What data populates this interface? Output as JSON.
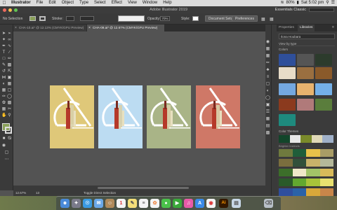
{
  "menubar": {
    "app": "Illustrator",
    "items": [
      "File",
      "Edit",
      "Object",
      "Type",
      "Select",
      "Effect",
      "View",
      "Window",
      "Help"
    ],
    "battery": "80%",
    "clock": "Sat 5:02 pm"
  },
  "window": {
    "title": "Adobe Illustrator 2019",
    "workspace": "Essentials Classic"
  },
  "control_bar": {
    "selection": "No Selection",
    "stroke_label": "Stroke:",
    "opacity_label": "Opacity:",
    "opacity_value": "70%",
    "style_label": "Style:",
    "document_setup": "Document Setup",
    "preferences": "Preferences"
  },
  "doc_tabs": [
    {
      "label": "CHA-10.ai* @ 12.13% (CMYK/GPU Preview)",
      "active": false
    },
    {
      "label": "CHA-09.ai* @ 12.67% (CMYK/GPU Preview)",
      "active": true
    }
  ],
  "status": {
    "zoom": "12.67%",
    "artboard": "13",
    "tool": "Toggle Direct Selection"
  },
  "artboards": [
    {
      "color": "#dfc879"
    },
    {
      "color": "#bcdcf2"
    },
    {
      "color": "#a9b487"
    },
    {
      "color": "#cf7867"
    }
  ],
  "panel": {
    "tabs": [
      "Properties",
      "Libraries"
    ],
    "library_name": "Ilona Houbara",
    "view_by": "View by type",
    "section_colors": "Colors",
    "section_color_themes": "Color Themes",
    "theme_name": "Brighter Instincts",
    "swatches": [
      "#2f4f9a",
      "#555555",
      "#2c3b2c",
      "#e8dcc8",
      "#9a6f40",
      "#8a5a2a",
      "#74a8e0",
      "#e8b36e",
      "#74b0e8",
      "#8b3a1e",
      "#b07a7a",
      "#5a7d3c",
      "#1e8a7e",
      "#ffffff",
      "#ffffff"
    ],
    "theme_row": [
      "#12452a",
      "#e8e8e8",
      "#7a8a2a",
      "#e0d9b8",
      "#9fb0c8"
    ],
    "theme_rows": [
      [
        "#6f7a3e",
        "#1f5e3a",
        "#e8c24a",
        "#a89c66"
      ],
      [
        "#7a6e3e",
        "#31503a",
        "#c8b26a",
        "#b4b89a"
      ],
      [
        "#3c6e2a",
        "#f0e8c8",
        "#a2c468",
        "#d8ba5a"
      ],
      [
        "#2a5a2a",
        "#62a830",
        "#a8c43a",
        "#e8e070"
      ],
      [
        "#2f4e9e",
        "#2a62a8",
        "#d8a83a",
        "#c8864a"
      ]
    ]
  },
  "dock": {
    "apps": [
      "Finder",
      "Launchpad",
      "Safari",
      "Mail",
      "Contacts",
      "Calendar",
      "Notes",
      "Reminders",
      "Photos",
      "Messages",
      "FaceTime",
      "iTunes",
      "App Store",
      "Chrome",
      "Illustrator",
      "Preview",
      "Trash"
    ]
  }
}
